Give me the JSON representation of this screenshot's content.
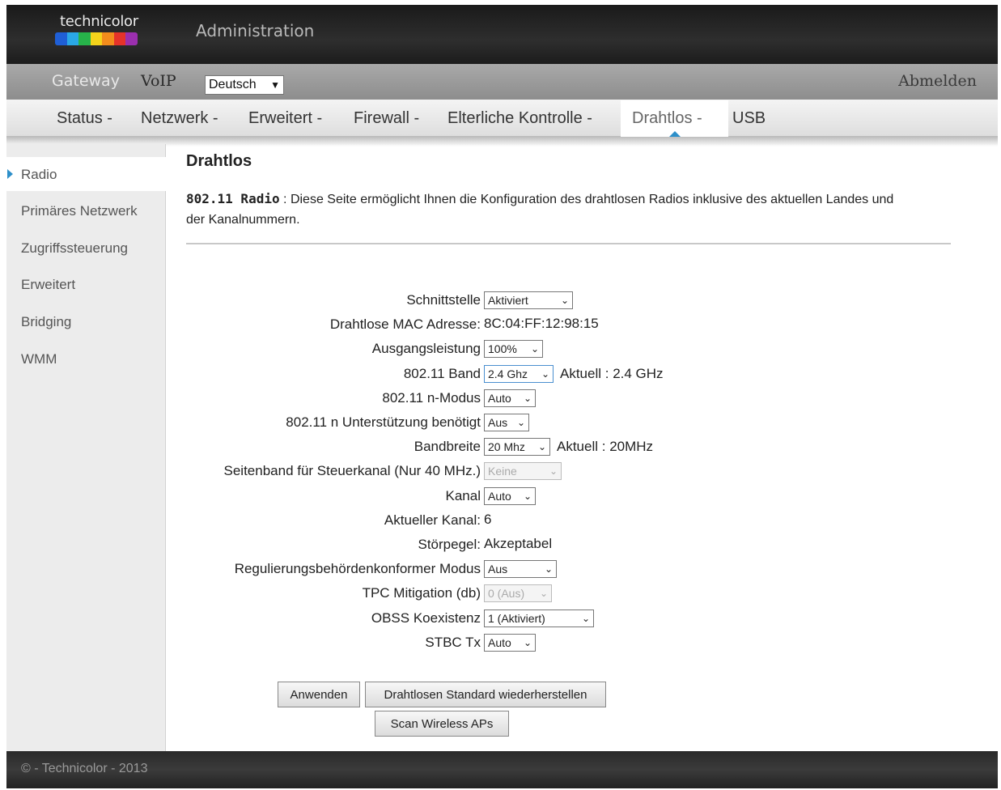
{
  "header": {
    "logo_text": "technicolor",
    "logo_colors": [
      "#1f5fd6",
      "#2aa8e6",
      "#27b34a",
      "#f4d31b",
      "#f28c1c",
      "#e5332a",
      "#9b2fae"
    ],
    "title": "Administration"
  },
  "subnav": {
    "items": [
      "Gateway",
      "VoIP"
    ],
    "language": "Deutsch",
    "logout": "Abmelden"
  },
  "tabs": [
    "Status -",
    "Netzwerk -",
    "Erweitert -",
    "Firewall -",
    "Elterliche Kontrolle -",
    "Drahtlos -",
    "USB"
  ],
  "sidebar": {
    "items": [
      "Radio",
      "Primäres Netzwerk",
      "Zugriffssteuerung",
      "Erweitert",
      "Bridging",
      "WMM"
    ]
  },
  "content": {
    "title": "Drahtlos",
    "desc_label": "802.11 Radio",
    "desc_sep": " : ",
    "desc_text": "Diese Seite ermöglicht Ihnen die Konfiguration des drahtlosen Radios inklusive des aktuellen Landes und der Kanalnummern.",
    "rows": [
      {
        "label": "Schnittstelle",
        "select": "Aktiviert"
      },
      {
        "label": "Drahtlose MAC Adresse:",
        "text": "8C:04:FF:12:98:15"
      },
      {
        "label": "Ausgangsleistung",
        "select": "100%"
      },
      {
        "label": "802.11 Band",
        "select": "2.4 Ghz",
        "extra": "Aktuell :  2.4 GHz"
      },
      {
        "label": "802.11 n-Modus",
        "select": "Auto"
      },
      {
        "label": "802.11 n Unterstützung benötigt",
        "select": "Aus"
      },
      {
        "label": "Bandbreite",
        "select": "20 Mhz",
        "extra": "Aktuell :  20MHz"
      },
      {
        "label": "Seitenband für Steuerkanal (Nur 40 MHz.)",
        "select": "Keine"
      },
      {
        "label": "Kanal",
        "select": "Auto"
      },
      {
        "label": "Aktueller Kanal:",
        "text": "6"
      },
      {
        "label": "Störpegel:",
        "text": "Akzeptabel"
      },
      {
        "label": "Regulierungsbehördenkonformer Modus",
        "select": "Aus"
      },
      {
        "label": "TPC Mitigation (db)",
        "select": "0 (Aus)"
      },
      {
        "label": "OBSS Koexistenz",
        "select": "1 (Aktiviert)"
      },
      {
        "label": "STBC Tx",
        "select": "Auto"
      }
    ],
    "buttons": {
      "apply": "Anwenden",
      "restore": "Drahtlosen Standard wiederherstellen",
      "scan": "Scan Wireless APs"
    }
  },
  "footer": {
    "text": "© - Technicolor - 2013"
  }
}
